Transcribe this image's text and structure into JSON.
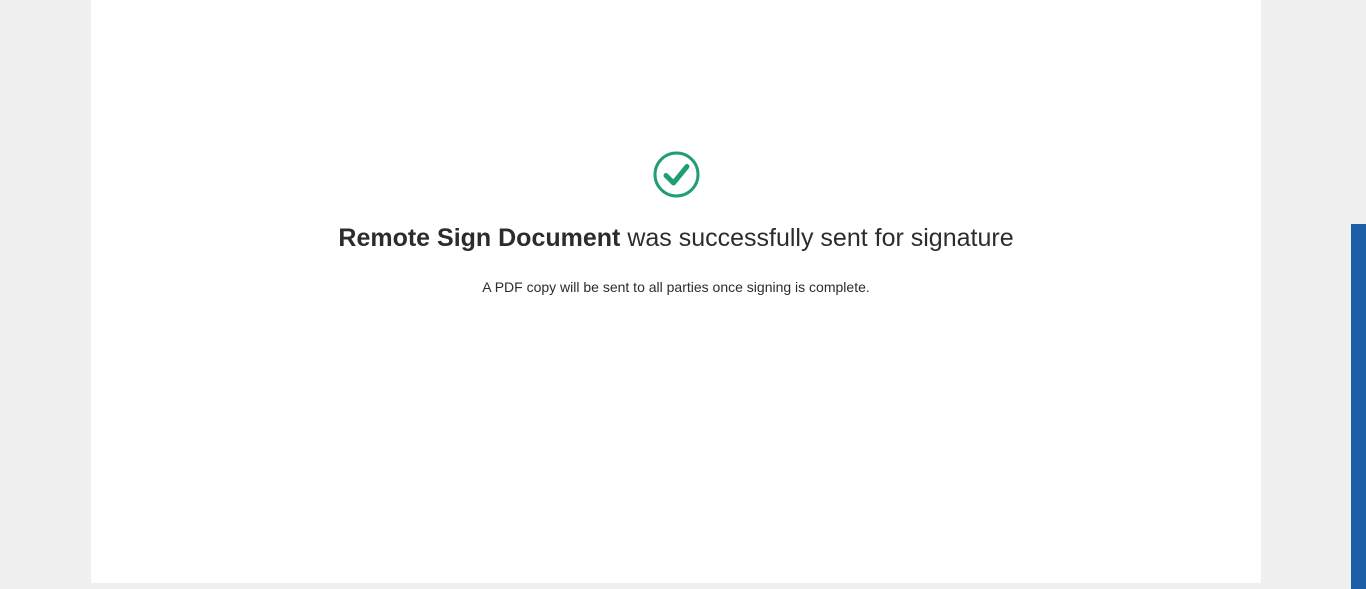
{
  "confirmation": {
    "document_name": "Remote Sign Document",
    "message_suffix": " was successfully sent for signature",
    "subtext": "A PDF copy will be sent to all parties once signing is complete.",
    "icon": "check-circle-icon"
  },
  "colors": {
    "success": "#1f9e75",
    "side_tab": "#1b5ea6",
    "background": "#f0f0f0",
    "card": "#ffffff",
    "text": "#2c2c2c"
  }
}
